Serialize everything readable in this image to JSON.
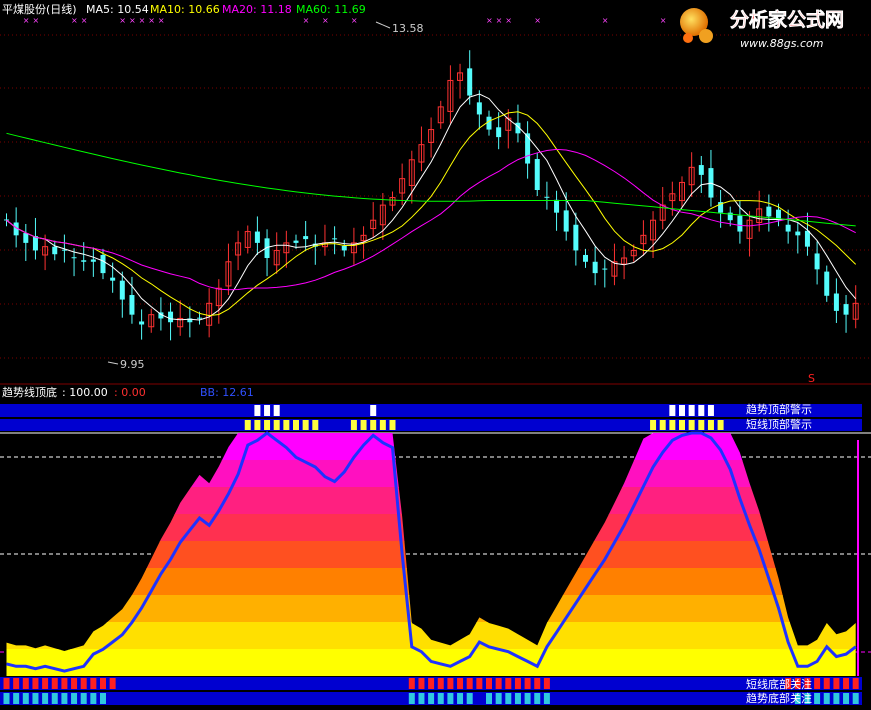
{
  "header": {
    "stock_title": "平煤股份(日线)",
    "ma5_label": "MA5: 10.54",
    "ma10_label": "MA10: 10.66",
    "ma20_label": "MA20: 11.18",
    "ma60_label": "MA60: 11.69"
  },
  "logo": {
    "name": "分析家公式网",
    "url": "www.88gs.com"
  },
  "indicator_header": {
    "name": "趋势线顶底",
    "value1": ": 100.00",
    "value2": ": 0.00",
    "bb_label": "BB: 12.61"
  },
  "band_labels": {
    "trend_top": "趋势顶部警示",
    "short_top": "短线顶部警示",
    "short_bottom": "短线底部关注",
    "trend_bottom": "趋势底部关注"
  },
  "colors": {
    "up": "#ff3232",
    "down": "#54fcfc",
    "ma5": "#ffffff",
    "ma10": "#ffff00",
    "ma20": "#ff00ff",
    "ma60": "#00ff00",
    "bb_line": "#1e32ff",
    "band_bg": "#0000d0"
  },
  "chart_data": {
    "type": "candlestick",
    "price_axis_range": [
      9.5,
      14.0
    ],
    "annotations": {
      "high": "13.58",
      "low": "9.95",
      "signal": "S"
    },
    "closes": [
      11.35,
      11.15,
      11.05,
      10.95,
      11.0,
      10.9,
      10.95,
      10.85,
      10.8,
      10.8,
      10.65,
      10.55,
      10.3,
      10.1,
      9.97,
      10.1,
      10.05,
      10.0,
      10.05,
      10.0,
      10.05,
      10.25,
      10.45,
      10.8,
      11.05,
      11.2,
      11.05,
      10.85,
      10.95,
      11.05,
      11.05,
      11.1,
      11.0,
      11.05,
      11.1,
      10.95,
      11.05,
      11.15,
      11.35,
      11.55,
      11.65,
      11.9,
      12.15,
      12.35,
      12.55,
      12.85,
      13.2,
      13.3,
      13.0,
      12.75,
      12.55,
      12.45,
      12.7,
      12.5,
      12.1,
      11.75,
      11.65,
      11.45,
      11.2,
      10.95,
      10.8,
      10.65,
      10.7,
      10.8,
      10.85,
      10.95,
      11.15,
      11.35,
      11.55,
      11.7,
      11.85,
      12.05,
      11.95,
      11.65,
      11.45,
      11.35,
      11.2,
      11.35,
      11.5,
      11.4,
      11.35,
      11.2,
      11.15,
      11.0,
      10.7,
      10.35,
      10.15,
      10.1,
      10.25
    ],
    "series": [
      {
        "name": "MA5",
        "value": 10.54
      },
      {
        "name": "MA10",
        "value": 10.66
      },
      {
        "name": "MA20",
        "value": 11.18
      },
      {
        "name": "MA60",
        "value": 11.69
      },
      {
        "name": "BB",
        "value": 12.61
      }
    ],
    "indicator": {
      "range": [
        0,
        100
      ],
      "bb_series": [
        5,
        4,
        4,
        3,
        4,
        3,
        2,
        3,
        4,
        9,
        11,
        14,
        17,
        22,
        28,
        35,
        42,
        48,
        55,
        60,
        65,
        62,
        68,
        75,
        83,
        95,
        97,
        100,
        97,
        94,
        90,
        88,
        86,
        82,
        80,
        84,
        90,
        95,
        99,
        96,
        94,
        50,
        12,
        10,
        6,
        5,
        4,
        6,
        8,
        14,
        12,
        11,
        10,
        8,
        6,
        4,
        12,
        18,
        24,
        30,
        36,
        42,
        48,
        55,
        62,
        70,
        78,
        86,
        92,
        97,
        99,
        100,
        100,
        98,
        93,
        85,
        73,
        62,
        52,
        40,
        28,
        14,
        4,
        4,
        6,
        12,
        8,
        9,
        12
      ]
    }
  }
}
